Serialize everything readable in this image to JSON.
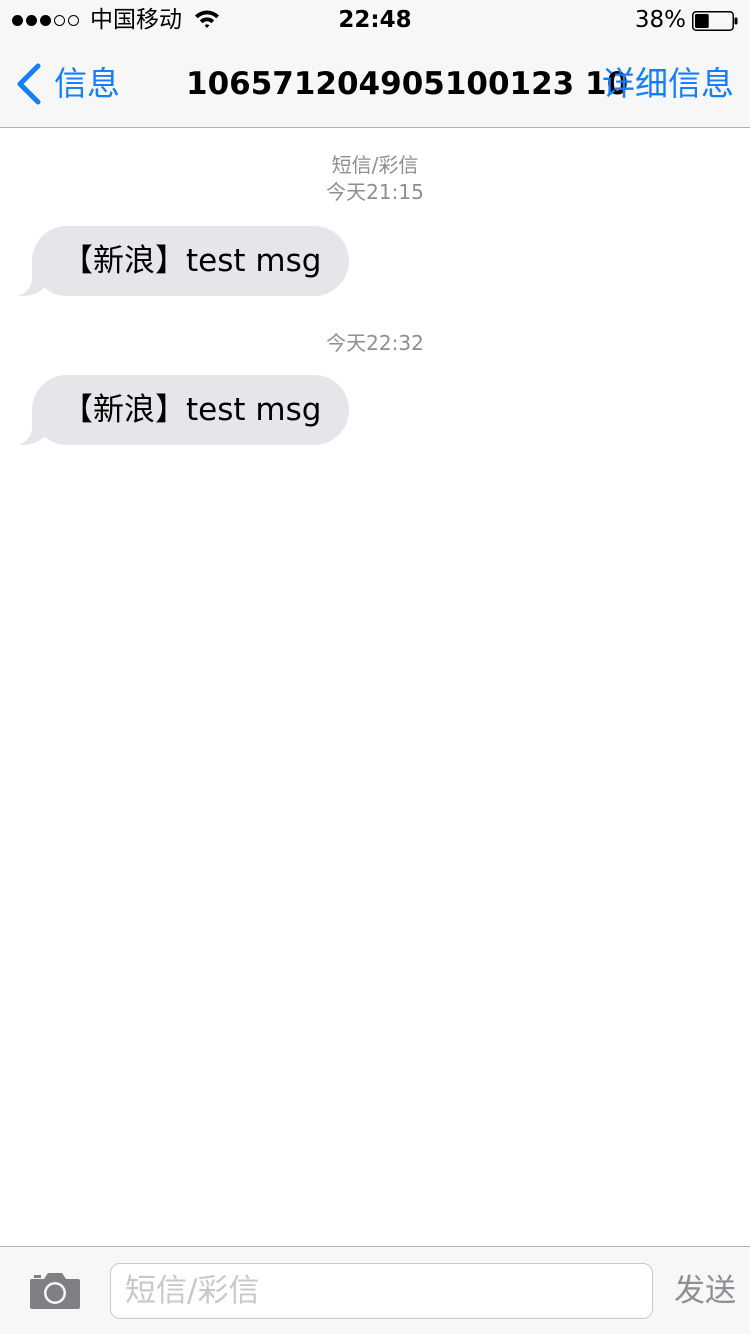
{
  "status_bar": {
    "signal_filled": 3,
    "signal_total": 5,
    "carrier": "中国移动",
    "time": "22:48",
    "battery_percent": "38%",
    "battery_level": 0.38
  },
  "nav": {
    "back_label": "信息",
    "title": "106571204905100123 10",
    "details_label": "详细信息"
  },
  "conversation": {
    "groups": [
      {
        "service": "短信/彩信",
        "timestamp": "今天21:15",
        "messages": [
          {
            "text": "【新浪】test msg"
          }
        ]
      },
      {
        "timestamp": "今天22:32",
        "messages": [
          {
            "text": "【新浪】test msg"
          }
        ]
      }
    ]
  },
  "input_bar": {
    "placeholder": "短信/彩信",
    "value": "",
    "send_label": "发送"
  },
  "colors": {
    "accent": "#157efb",
    "bubble_incoming": "#e5e5ea",
    "secondary_text": "#8e8e93",
    "bar_background": "#f7f7f7"
  }
}
